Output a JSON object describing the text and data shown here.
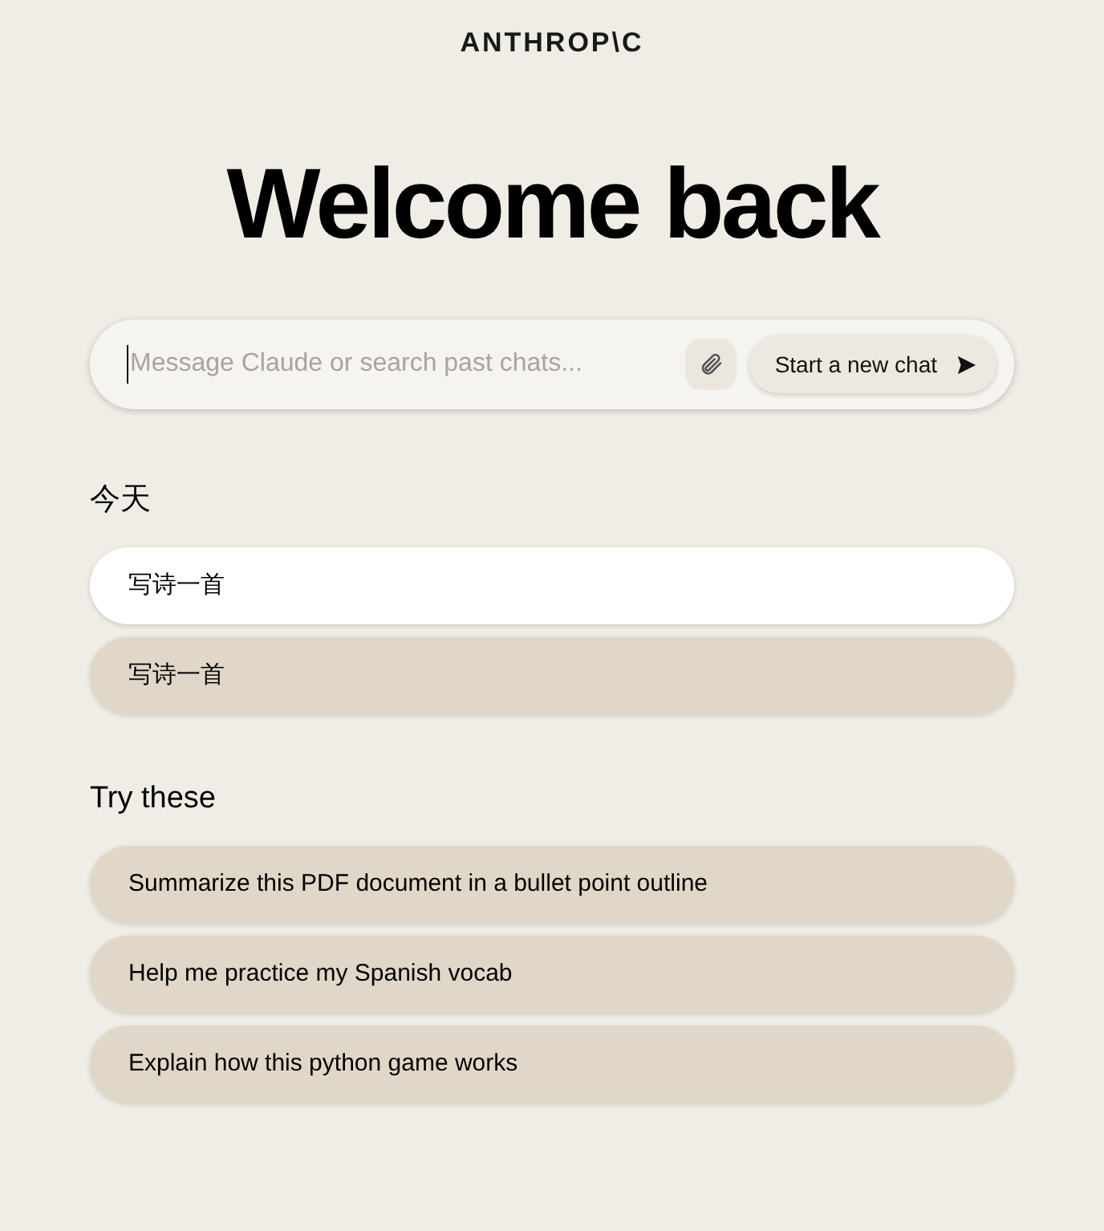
{
  "logo": "ANTHROP\\C",
  "heading": "Welcome back",
  "search": {
    "placeholder": "Message Claude or search past chats...",
    "button": "Start a new chat"
  },
  "recent": {
    "title": "今天",
    "items": [
      {
        "label": "写诗一首",
        "selected": true
      },
      {
        "label": "写诗一首",
        "selected": false
      }
    ]
  },
  "suggestions": {
    "title": "Try these",
    "items": [
      {
        "label": "Summarize this PDF document in a bullet point outline"
      },
      {
        "label": "Help me practice my Spanish vocab"
      },
      {
        "label": "Explain how this python game works"
      }
    ]
  }
}
